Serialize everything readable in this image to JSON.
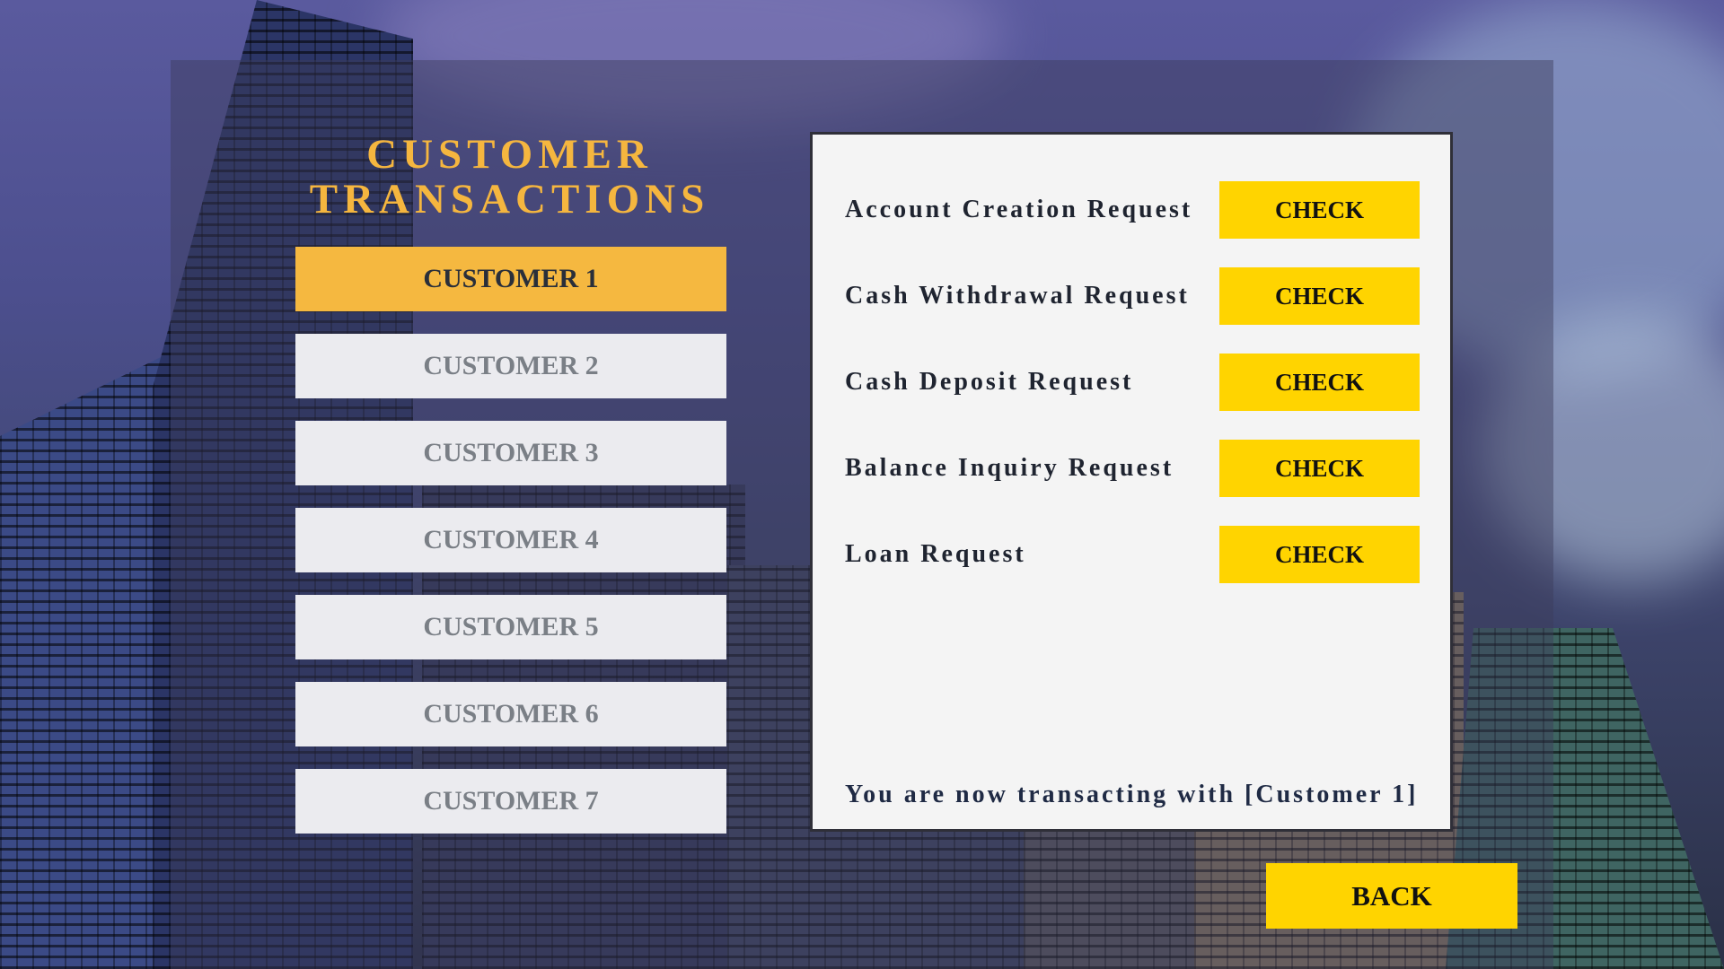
{
  "colors": {
    "accent_gold": "#f5b840",
    "check_yellow": "#ffd400",
    "inactive_button": "#ebebef",
    "panel_background": "#f4f4f4"
  },
  "title": {
    "line1": "CUSTOMER",
    "line2": "TRANSACTIONS"
  },
  "customers": [
    {
      "label": "CUSTOMER 1",
      "active": true
    },
    {
      "label": "CUSTOMER 2",
      "active": false
    },
    {
      "label": "CUSTOMER 3",
      "active": false
    },
    {
      "label": "CUSTOMER 4",
      "active": false
    },
    {
      "label": "CUSTOMER 5",
      "active": false
    },
    {
      "label": "CUSTOMER 6",
      "active": false
    },
    {
      "label": "CUSTOMER 7",
      "active": false
    }
  ],
  "requests": [
    {
      "label": "Account Creation Request",
      "button": "CHECK"
    },
    {
      "label": "Cash Withdrawal Request",
      "button": "CHECK"
    },
    {
      "label": "Cash Deposit Request",
      "button": "CHECK"
    },
    {
      "label": "Balance Inquiry Request",
      "button": "CHECK"
    },
    {
      "label": "Loan Request",
      "button": "CHECK"
    }
  ],
  "status_text": "You are now transacting with [Customer 1]",
  "back_label": "BACK"
}
